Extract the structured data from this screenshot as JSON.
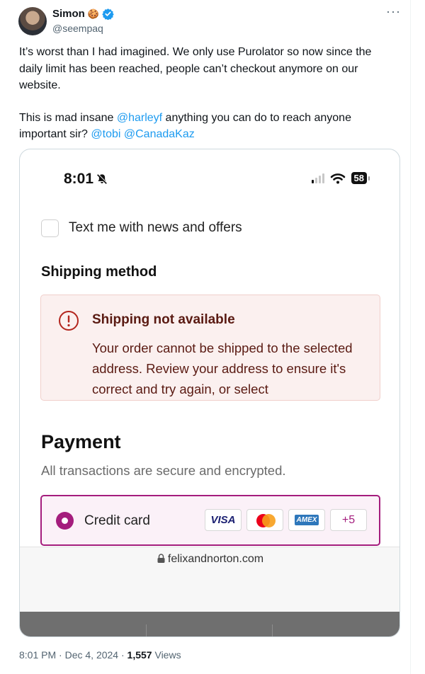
{
  "author": {
    "name": "Simon",
    "emoji": "🍪",
    "handle": "@seempaq"
  },
  "more_label": "···",
  "tweet": {
    "p1": "It’s worst than I had imagined. We only use Purolator so now since the daily limit has been reached, people can’t checkout anymore on our website.",
    "p2_before": "This is mad insane ",
    "mention1": "@harleyf",
    "p2_middle": " anything you can do to reach anyone important sir? ",
    "mention2": "@tobi",
    "p2_space": " ",
    "mention3": "@CanadaKaz"
  },
  "screenshot": {
    "status_time": "8:01",
    "battery": "58",
    "checkbox_label": "Text me with news and offers",
    "shipping_heading": "Shipping method",
    "alert_title": "Shipping not available",
    "alert_body": "Your order cannot be shipped to the selected address. Review your address to ensure it's correct and try again, or select",
    "payment_heading": "Payment",
    "payment_sub": "All transactions are secure and encrypted.",
    "credit_card_label": "Credit card",
    "cards": {
      "visa": "VISA",
      "amex": "AMEX",
      "more": "+5"
    },
    "url": "felixandnorton.com",
    "accent_color": "#a41d7d"
  },
  "meta": {
    "time": "8:01 PM",
    "sep1": " · ",
    "date": "Dec 4, 2024",
    "sep2": " · ",
    "views_count": "1,557",
    "views_label": " Views"
  }
}
